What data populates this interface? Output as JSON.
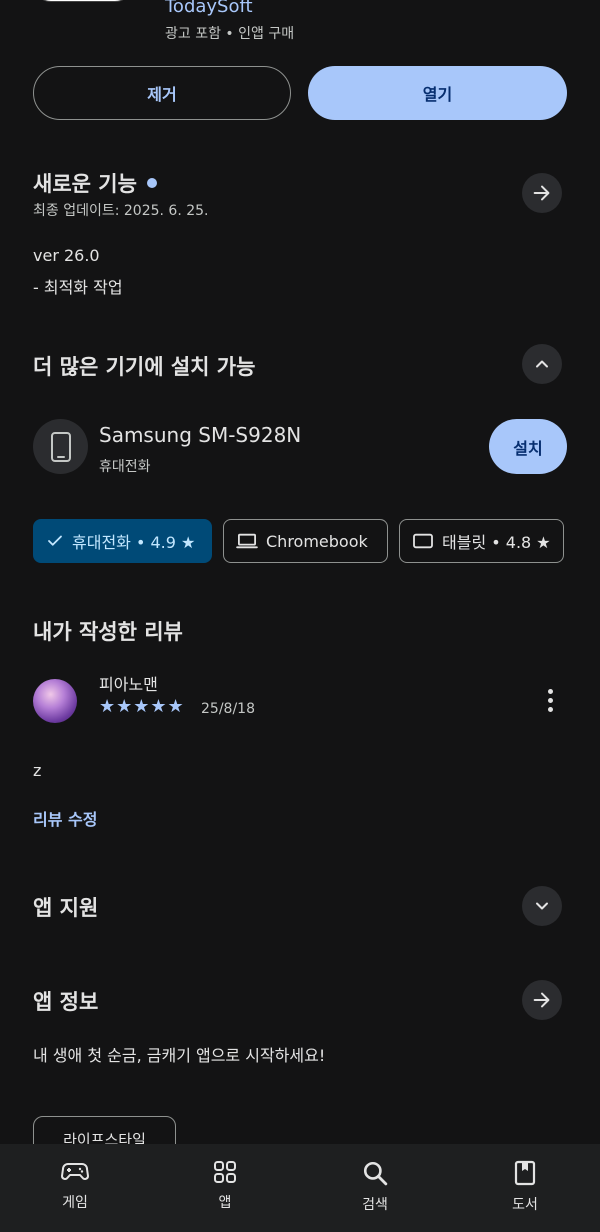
{
  "header": {
    "developer": "TodaySoft",
    "meta": "광고 포함  •  인앱 구매"
  },
  "actions": {
    "uninstall_label": "제거",
    "open_label": "열기"
  },
  "whats_new": {
    "title": "새로운 기능",
    "updated": "최종 업데이트: 2025. 6. 25.",
    "version": "ver 26.0",
    "notes": "- 최적화 작업"
  },
  "devices": {
    "title": "더 많은 기기에 설치 가능",
    "device_name": "Samsung SM-S928N",
    "device_type": "휴대전화",
    "install_label": "설치"
  },
  "chips": [
    {
      "label": "휴대전화 • 4.9 ★",
      "selected": true
    },
    {
      "label": "Chromebook",
      "selected": false
    },
    {
      "label": "태블릿 • 4.8 ★",
      "selected": false
    }
  ],
  "my_review": {
    "title": "내가 작성한 리뷰",
    "reviewer": "피아노맨",
    "stars": "★★★★★",
    "rating": 5,
    "date": "25/8/18",
    "text": "z",
    "edit_label": "리뷰 수정"
  },
  "app_support": {
    "title": "앱 지원"
  },
  "app_info": {
    "title": "앱 정보",
    "description": "내 생애 첫 순금, 금캐기 앱으로 시작하세요!",
    "category_tag": "라이프스타일"
  },
  "bottom_nav": [
    {
      "label": "게임",
      "icon": "gamepad-icon"
    },
    {
      "label": "앱",
      "icon": "apps-grid-icon"
    },
    {
      "label": "검색",
      "icon": "search-icon"
    },
    {
      "label": "도서",
      "icon": "book-icon"
    }
  ],
  "colors": {
    "background": "#131314",
    "accent": "#a8c7fa",
    "chip_selected": "#004a77"
  }
}
